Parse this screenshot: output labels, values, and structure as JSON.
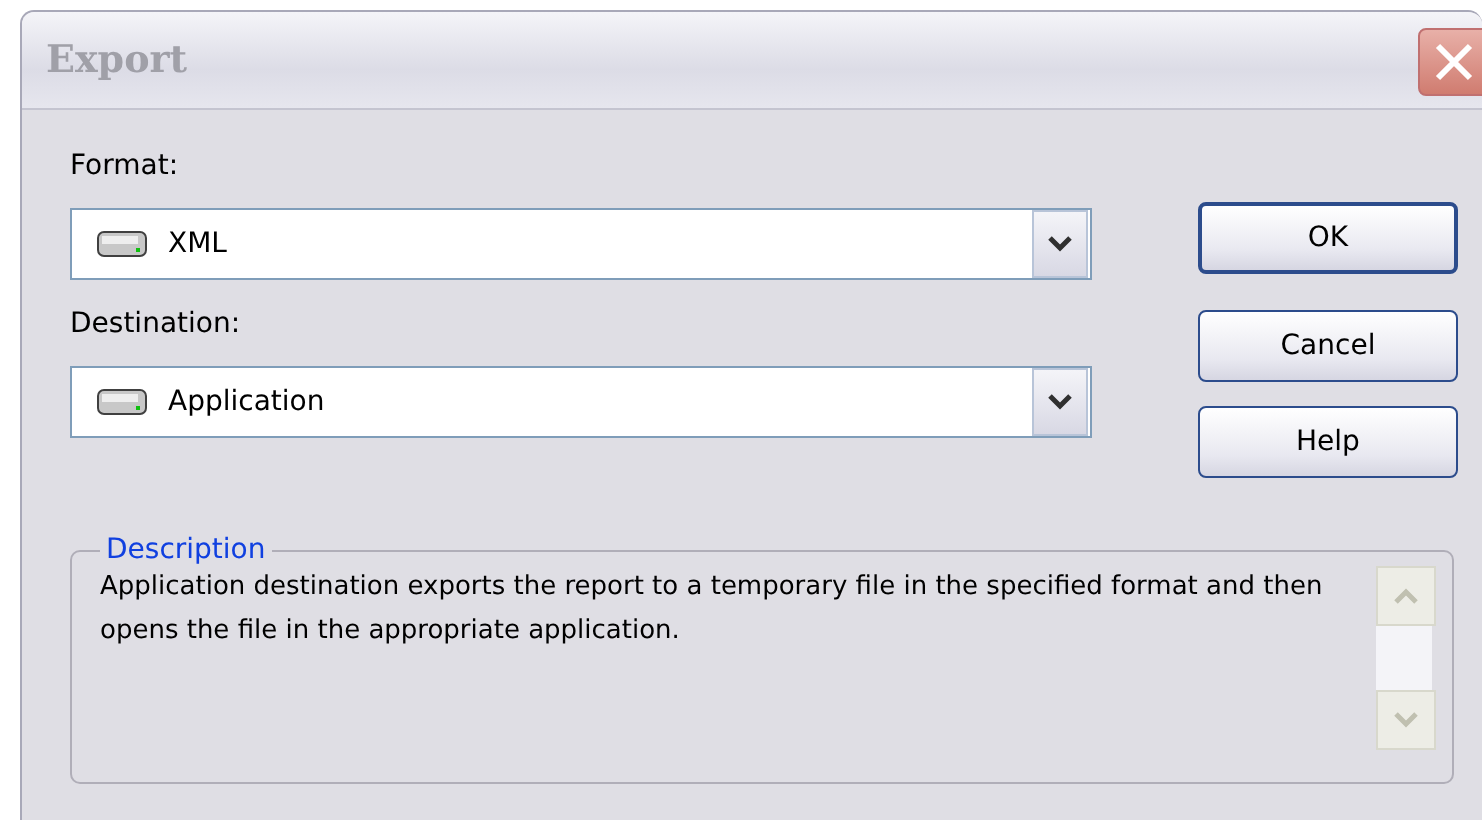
{
  "window": {
    "title": "Export"
  },
  "format": {
    "label": "Format:",
    "value": "XML"
  },
  "destination": {
    "label": "Destination:",
    "value": "Application"
  },
  "buttons": [
    {
      "label": "OK",
      "default": true
    },
    {
      "label": "Cancel",
      "default": false
    },
    {
      "label": "Help",
      "default": false
    }
  ],
  "description": {
    "legend": "Description",
    "text": "Application destination exports the report to a temporary file in the specified format and then opens the file in the appropriate application."
  }
}
